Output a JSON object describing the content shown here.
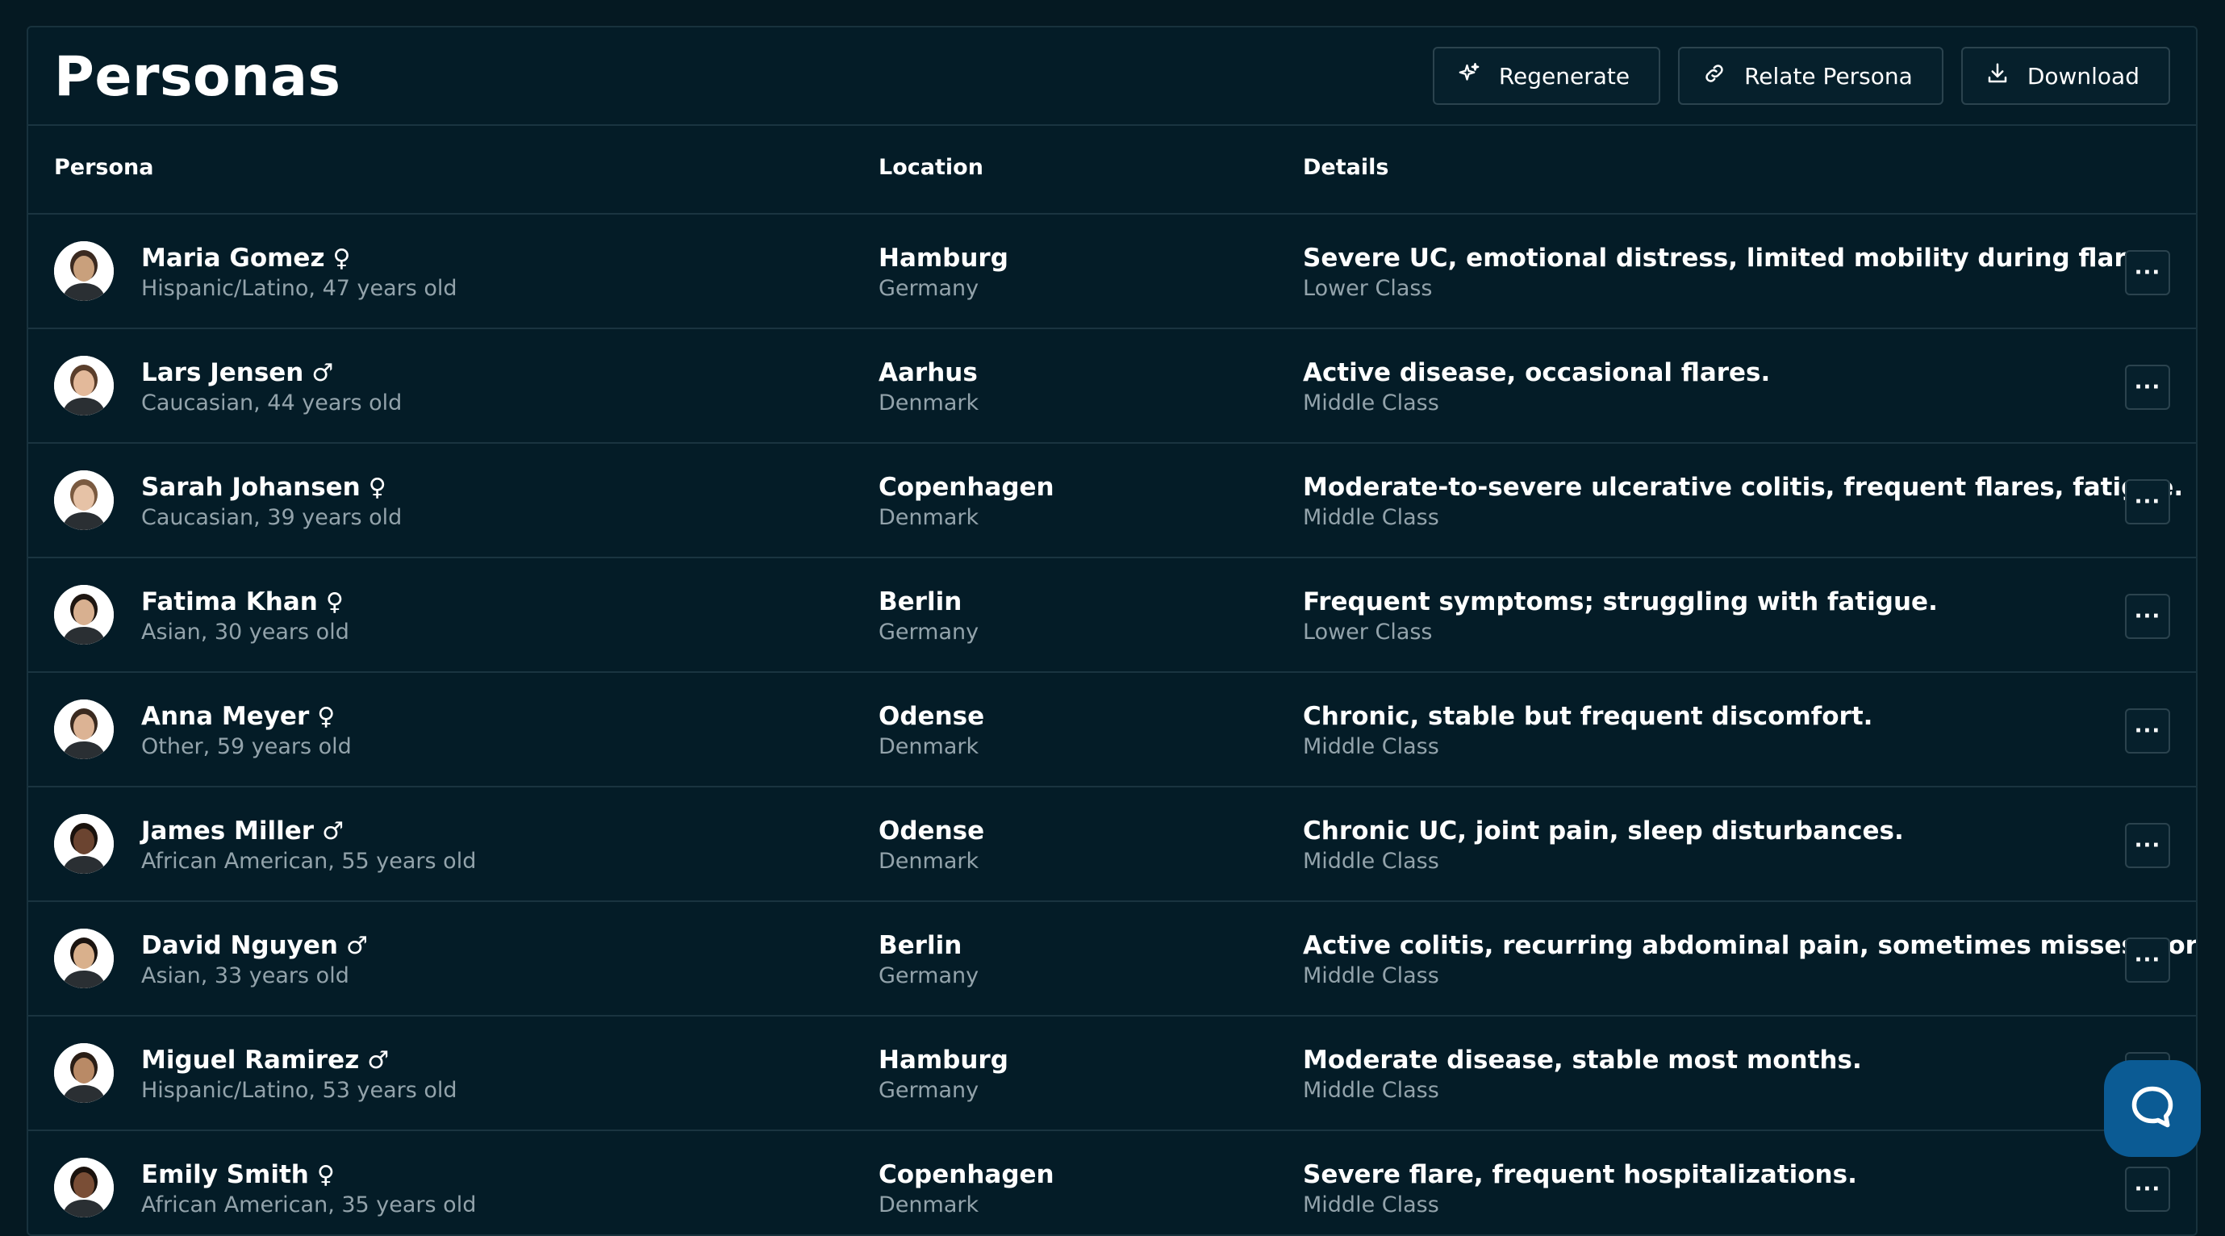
{
  "page": {
    "title": "Personas"
  },
  "actions": {
    "regenerate": "Regenerate",
    "relate": "Relate Persona",
    "download": "Download"
  },
  "table": {
    "headers": {
      "persona": "Persona",
      "location": "Location",
      "details": "Details"
    },
    "more_label": "···",
    "rows": [
      {
        "name": "Maria Gomez",
        "gender": "♀",
        "demo": "Hispanic/Latino, 47 years old",
        "city": "Hamburg",
        "country": "Germany",
        "detail": "Severe UC, emotional distress, limited mobility during flares.",
        "class": "Lower Class",
        "skin": "#c9a07c",
        "hair": "#3b2a20"
      },
      {
        "name": "Lars Jensen",
        "gender": "♂",
        "demo": "Caucasian, 44 years old",
        "city": "Aarhus",
        "country": "Denmark",
        "detail": "Active disease, occasional flares.",
        "class": "Middle Class",
        "skin": "#e3b99a",
        "hair": "#5a3e2b"
      },
      {
        "name": "Sarah Johansen",
        "gender": "♀",
        "demo": "Caucasian, 39 years old",
        "city": "Copenhagen",
        "country": "Denmark",
        "detail": "Moderate-to-severe ulcerative colitis, frequent flares, fatigue.",
        "class": "Middle Class",
        "skin": "#e6c2a6",
        "hair": "#7a5a40"
      },
      {
        "name": "Fatima Khan",
        "gender": "♀",
        "demo": "Asian, 30 years old",
        "city": "Berlin",
        "country": "Germany",
        "detail": "Frequent symptoms; struggling with fatigue.",
        "class": "Lower Class",
        "skin": "#d8b090",
        "hair": "#1e1611"
      },
      {
        "name": "Anna Meyer",
        "gender": "♀",
        "demo": "Other, 59 years old",
        "city": "Odense",
        "country": "Denmark",
        "detail": "Chronic, stable but frequent discomfort.",
        "class": "Middle Class",
        "skin": "#dcb394",
        "hair": "#3a2a1f"
      },
      {
        "name": "James Miller",
        "gender": "♂",
        "demo": "African American, 55 years old",
        "city": "Odense",
        "country": "Denmark",
        "detail": "Chronic UC, joint pain, sleep disturbances.",
        "class": "Middle Class",
        "skin": "#6b4430",
        "hair": "#1a120d"
      },
      {
        "name": "David Nguyen",
        "gender": "♂",
        "demo": "Asian, 33 years old",
        "city": "Berlin",
        "country": "Germany",
        "detail": "Active colitis, recurring abdominal pain, sometimes misses work.",
        "class": "Middle Class",
        "skin": "#d9b08c",
        "hair": "#1b1410"
      },
      {
        "name": "Miguel Ramirez",
        "gender": "♂",
        "demo": "Hispanic/Latino, 53 years old",
        "city": "Hamburg",
        "country": "Germany",
        "detail": "Moderate disease, stable most months.",
        "class": "Middle Class",
        "skin": "#b98a66",
        "hair": "#2a1e16"
      },
      {
        "name": "Emily Smith",
        "gender": "♀",
        "demo": "African American, 35 years old",
        "city": "Copenhagen",
        "country": "Denmark",
        "detail": "Severe flare, frequent hospitalizations.",
        "class": "Middle Class",
        "skin": "#7a4e36",
        "hair": "#1a120d"
      }
    ]
  }
}
